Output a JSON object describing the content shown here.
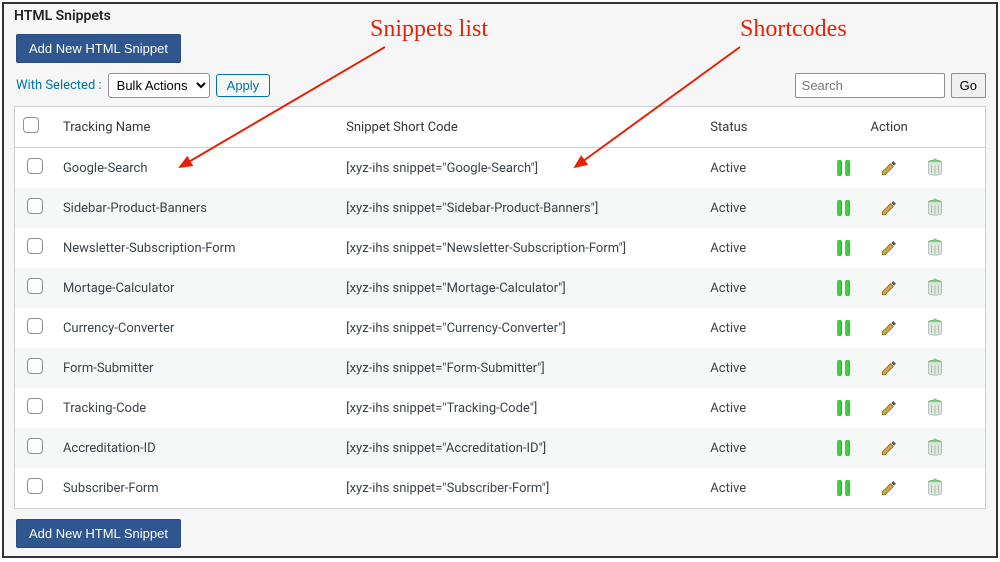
{
  "panel": {
    "title": "HTML Snippets"
  },
  "buttons": {
    "add_new": "Add New HTML Snippet",
    "apply": "Apply",
    "go": "Go"
  },
  "filters": {
    "with_selected_label": "With Selected :",
    "bulk_actions": "Bulk Actions",
    "search_placeholder": "Search"
  },
  "columns": {
    "tracking_name": "Tracking Name",
    "short_code": "Snippet Short Code",
    "status": "Status",
    "action": "Action"
  },
  "rows": [
    {
      "name": "Google-Search",
      "short": "[xyz-ihs snippet=\"Google-Search\"]",
      "status": "Active"
    },
    {
      "name": "Sidebar-Product-Banners",
      "short": "[xyz-ihs snippet=\"Sidebar-Product-Banners\"]",
      "status": "Active"
    },
    {
      "name": "Newsletter-Subscription-Form",
      "short": "[xyz-ihs snippet=\"Newsletter-Subscription-Form\"]",
      "status": "Active"
    },
    {
      "name": "Mortage-Calculator",
      "short": "[xyz-ihs snippet=\"Mortage-Calculator\"]",
      "status": "Active"
    },
    {
      "name": "Currency-Converter",
      "short": "[xyz-ihs snippet=\"Currency-Converter\"]",
      "status": "Active"
    },
    {
      "name": "Form-Submitter",
      "short": "[xyz-ihs snippet=\"Form-Submitter\"]",
      "status": "Active"
    },
    {
      "name": "Tracking-Code",
      "short": "[xyz-ihs snippet=\"Tracking-Code\"]",
      "status": "Active"
    },
    {
      "name": "Accreditation-ID",
      "short": "[xyz-ihs snippet=\"Accreditation-ID\"]",
      "status": "Active"
    },
    {
      "name": "Subscriber-Form",
      "short": "[xyz-ihs snippet=\"Subscriber-Form\"]",
      "status": "Active"
    }
  ],
  "annotations": {
    "snippets_list": "Snippets list",
    "shortcodes": "Shortcodes"
  }
}
